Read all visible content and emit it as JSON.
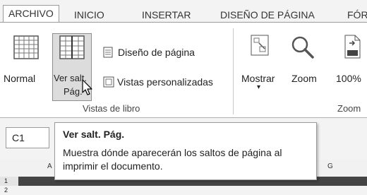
{
  "tabs": [
    {
      "label": "ARCHIVO",
      "active": true
    },
    {
      "label": "INICIO"
    },
    {
      "label": "INSERTAR"
    },
    {
      "label": "DISEÑO DE PÁGINA"
    },
    {
      "label": "FÓR"
    }
  ],
  "ribbon": {
    "normal_label": "Normal",
    "ver_salt_line1": "Ver salt.",
    "ver_salt_line2": "Pág.",
    "diseno_label": "Diseño de página",
    "vistas_pers_label": "Vistas personalizadas",
    "group_vistas": "Vistas de libro",
    "mostrar_label": "Mostrar",
    "zoom_label": "Zoom",
    "zoom100_label": "100%",
    "zoom100_badge": "100",
    "group_zoom": "Zoom"
  },
  "namebox": {
    "value": "C1"
  },
  "columns": [
    "A",
    "G"
  ],
  "rows": [
    "1",
    "2"
  ],
  "tooltip": {
    "title": "Ver salt. Pág.",
    "description": "Muestra dónde aparecerán los saltos de página al imprimir el documento."
  },
  "colors": {
    "accent": "#217346",
    "ribbon_bg": "#ffffff",
    "tab_bg": "#f3f3f3"
  }
}
